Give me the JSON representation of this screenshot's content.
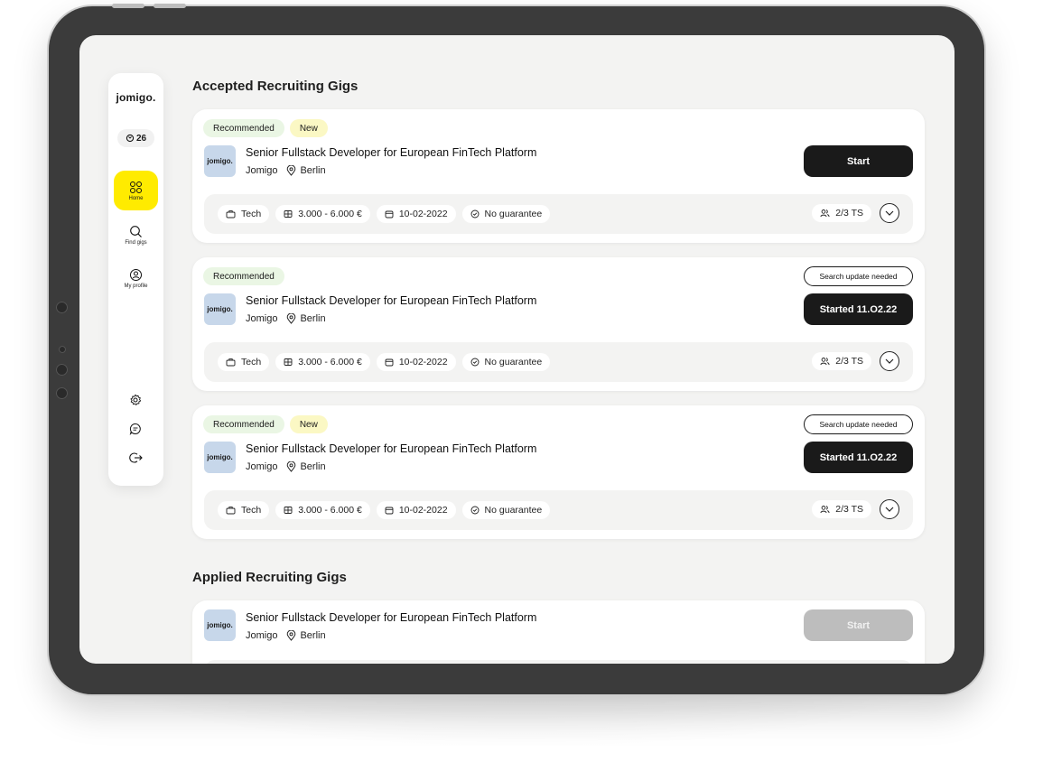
{
  "app": {
    "logo": "jomigo.",
    "credits": "26"
  },
  "sidebar": {
    "nav": [
      {
        "label": "Home",
        "icon": "grid-icon",
        "active": true
      },
      {
        "label": "Find gigs",
        "icon": "search-icon",
        "active": false
      },
      {
        "label": "My profile",
        "icon": "user-icon",
        "active": false
      }
    ],
    "bottom_icons": [
      "gear-icon",
      "chat-icon",
      "logout-icon"
    ]
  },
  "sections": {
    "accepted_title": "Accepted Recruiting Gigs",
    "applied_title": "Applied Recruiting Gigs"
  },
  "gigs": [
    {
      "tags": [
        "Recommended",
        "New"
      ],
      "thumb": "jomigo.",
      "title": "Senior Fullstack Developer for European FinTech Platform",
      "company": "Jomigo",
      "location": "Berlin",
      "status_outline": "",
      "action": "Start",
      "category": "Tech",
      "salary": "3.000 - 6.000 €",
      "date": "10-02-2022",
      "guarantee": "No guarantee",
      "ts": "2/3 TS"
    },
    {
      "tags": [
        "Recommended"
      ],
      "thumb": "jomigo.",
      "title": "Senior Fullstack Developer for European FinTech Platform",
      "company": "Jomigo",
      "location": "Berlin",
      "status_outline": "Search update needed",
      "action": "Started 11.O2.22",
      "category": "Tech",
      "salary": "3.000 - 6.000 €",
      "date": "10-02-2022",
      "guarantee": "No guarantee",
      "ts": "2/3 TS"
    },
    {
      "tags": [
        "Recommended",
        "New"
      ],
      "thumb": "jomigo.",
      "title": "Senior Fullstack Developer for European FinTech Platform",
      "company": "Jomigo",
      "location": "Berlin",
      "status_outline": "Search update needed",
      "action": "Started 11.O2.22",
      "category": "Tech",
      "salary": "3.000 - 6.000 €",
      "date": "10-02-2022",
      "guarantee": "No guarantee",
      "ts": "2/3 TS"
    }
  ],
  "applied": [
    {
      "thumb": "jomigo.",
      "title": "Senior Fullstack Developer for European FinTech Platform",
      "company": "Jomigo",
      "location": "Berlin",
      "action": "Start"
    }
  ],
  "colors": {
    "accent": "#ffeb00",
    "dark": "#1a1a1a",
    "recommended_bg": "#eaf6e4",
    "new_bg": "#fbf8c4",
    "thumb_bg": "#c7d7ea"
  }
}
